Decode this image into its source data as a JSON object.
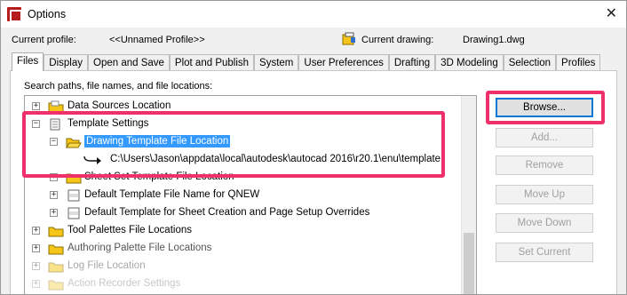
{
  "window": {
    "title": "Options",
    "close_glyph": "✕"
  },
  "profile": {
    "current_profile_label": "Current profile:",
    "current_profile_value": "<<Unnamed Profile>>",
    "current_drawing_label": "Current drawing:",
    "current_drawing_value": "Drawing1.dwg"
  },
  "tabs": [
    {
      "label": "Files",
      "active": true
    },
    {
      "label": "Display"
    },
    {
      "label": "Open and Save"
    },
    {
      "label": "Plot and Publish"
    },
    {
      "label": "System"
    },
    {
      "label": "User Preferences"
    },
    {
      "label": "Drafting"
    },
    {
      "label": "3D Modeling"
    },
    {
      "label": "Selection"
    },
    {
      "label": "Profiles"
    }
  ],
  "files": {
    "tree_caption": "Search paths, file names, and file locations:",
    "tree": {
      "data_sources": "Data Sources Location",
      "template_settings": "Template Settings",
      "drawing_template_location": "Drawing Template File Location",
      "template_path": "C:\\Users\\Jason\\appdata\\local\\autodesk\\autocad 2016\\r20.1\\enu\\template",
      "sheet_set_template": "Sheet Set Template File Location",
      "default_template_qnew": "Default Template File Name for QNEW",
      "default_template_sheet": "Default Template for Sheet Creation and Page Setup Overrides",
      "tool_palettes": "Tool Palettes File Locations",
      "authoring_palette": "Authoring Palette File Locations",
      "log_file": "Log File Location",
      "action_recorder": "Action Recorder Settings"
    },
    "buttons": {
      "browse": "Browse...",
      "add": "Add...",
      "remove": "Remove",
      "move_up": "Move Up",
      "move_down": "Move Down",
      "set_current": "Set Current"
    }
  },
  "colors": {
    "highlight": "#f0306b",
    "selection": "#3399ff",
    "folder_yellow": "#f5c518"
  }
}
